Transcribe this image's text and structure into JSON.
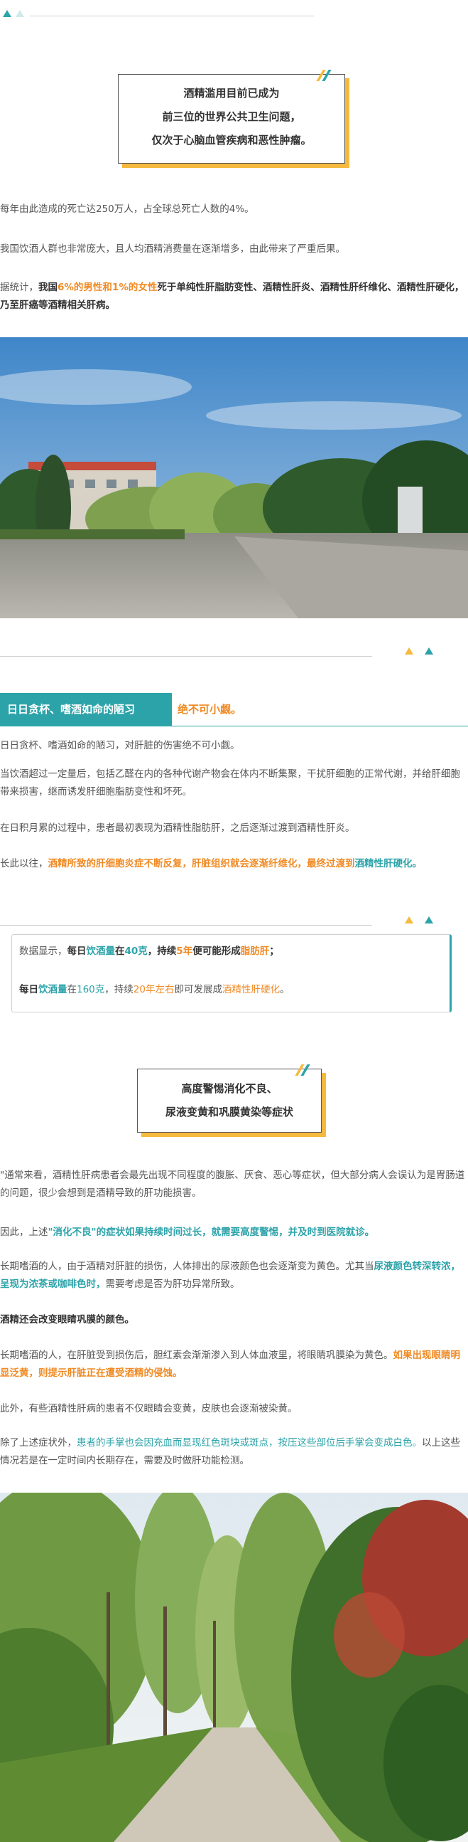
{
  "colors": {
    "teal": "#2ca3a9",
    "orange": "#f08a24",
    "yellow": "#f5b93d"
  },
  "intro": {
    "title_lines": [
      "酒精滥用目前已成为",
      "前三位的世界公共卫生问题，",
      "仅次于心脑血管疾病和恶性肿瘤。"
    ],
    "p1": "每年由此造成的死亡达250万人，占全球总死亡人数的4%。",
    "p2": "我国饮酒人群也非常庞大，且人均酒精消费量在逐渐增多，由此带来了严重后果。",
    "p3": {
      "a": "据统计，",
      "b": "我国",
      "c": "6%的男性和1%的女性",
      "d": "死于单纯性肝脂肪变性、酒精性肝炎、酒精性肝纤维化、酒精性肝硬化，乃至肝癌等酒精相关肝病。"
    }
  },
  "section1": {
    "tag": "日日贪杯、嗜酒如命的陋习",
    "tag_suffix": "绝不可小觑。",
    "p1": "日日贪杯、嗜酒如命的陋习，对肝脏的伤害绝不可小觑。",
    "p2": "当饮酒超过一定量后，包括乙醛在内的各种代谢产物会在体内不断集聚，干扰肝细胞的正常代谢，并给肝细胞带来损害，继而诱发肝细胞脂肪变性和坏死。",
    "p3": "在日积月累的过程中，患者最初表现为酒精性脂肪肝，之后逐渐过渡到酒精性肝炎。",
    "p4": {
      "a": "长此以往，",
      "b": "酒精所致的肝细胞炎症不断反复，",
      "c": "肝脏组织就会逐渐纤维化，",
      "d": "最终过渡到",
      "e": "酒精性肝硬化。"
    },
    "box": {
      "l1a": "数据显示，",
      "l1b": "每日",
      "l1c": "饮酒量",
      "l1d": "在",
      "l1e": "40克",
      "l1f": "，持续",
      "l1g": "5年",
      "l1h": "便可能形成",
      "l1i": "脂肪肝",
      "l1j": "；",
      "l2a": "每日",
      "l2b": "饮酒量",
      "l2c": "在",
      "l2d": "160克",
      "l2e": "，持续",
      "l2f": "20年左右",
      "l2g": "即可发展成",
      "l2h": "酒精性肝硬化",
      "l2i": "。"
    }
  },
  "section2": {
    "title_lines": [
      "高度警惕消化不良、",
      "尿液变黄和巩膜黄染等症状"
    ],
    "p1": "\"通常来看，酒精性肝病患者会最先出现不同程度的腹胀、厌食、恶心等症状，但大部分病人会误认为是胃肠道的问题，很少会想到是酒精导致的肝功能损害。",
    "p2": {
      "a": "因此，上述",
      "b": "\"消化不良\"的症状如果持续时间过长，",
      "c": "就需要高度警惕，并及时到医院就诊。"
    },
    "p3": {
      "a": "长期嗜酒的人，由于酒精对肝脏的损伤，人体排出的尿液颜色也会逐渐变为黄色。尤其当",
      "b": "尿液颜色转深转浓，",
      "c": "呈现为浓茶或咖啡色时，",
      "d": "需要考虑是否为肝功异常所致。"
    },
    "p4": "酒精还会改变眼睛巩膜的颜色。",
    "p5": {
      "a": "长期嗜酒的人，在肝脏受到损伤后，胆红素会渐渐渗入到人体血液里，将眼睛巩膜染为黄色。",
      "b": "如果出现眼睛明显泛黄，",
      "c": "则提示肝脏正在遭受酒精的侵蚀。"
    },
    "p6": "此外，有些酒精性肝病的患者不仅眼睛会变黄，皮肤也会逐渐被染黄。",
    "p7": {
      "a": "除了上述症状外，",
      "b": "患者的手掌也会因充血而显现红色斑块或斑点，按压这些部位后手掌会变成白色。",
      "c": "以上这些情况若是在一定时间内长期存在，需要及时做肝功能检测。"
    }
  }
}
